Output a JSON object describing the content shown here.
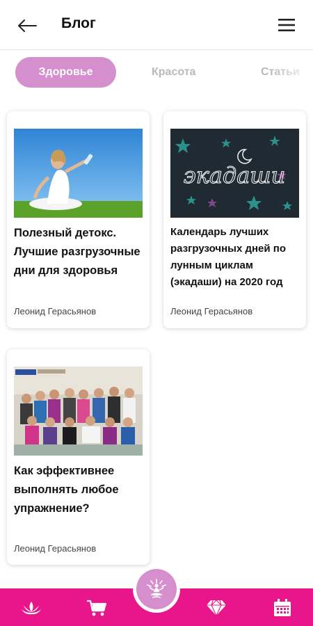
{
  "header": {
    "title": "Блог"
  },
  "tabs": [
    {
      "label": "Здоровье",
      "active": true
    },
    {
      "label": "Красота",
      "active": false
    },
    {
      "label": "Статьи",
      "active": false
    }
  ],
  "posts": [
    {
      "title": "Полезный детокс. Лучшие разгрузочные дни для здоровья",
      "author": "Леонид Герасьянов"
    },
    {
      "title": "Календарь лучших разгрузочных дней по лунным циклам (экадаши) на 2020 год",
      "author": "Леонид Герасьянов",
      "image_text": "экадаши"
    },
    {
      "title": "Как эффективнее выполнять любое упражнение?",
      "author": "Леонид Герасьянов"
    }
  ],
  "bottom_nav": {
    "items": [
      "lotus-icon",
      "cart-icon",
      "meditation-icon",
      "diamond-icon",
      "calendar-icon"
    ]
  },
  "colors": {
    "accent": "#e8168a",
    "tab_active": "#d48fcc"
  }
}
